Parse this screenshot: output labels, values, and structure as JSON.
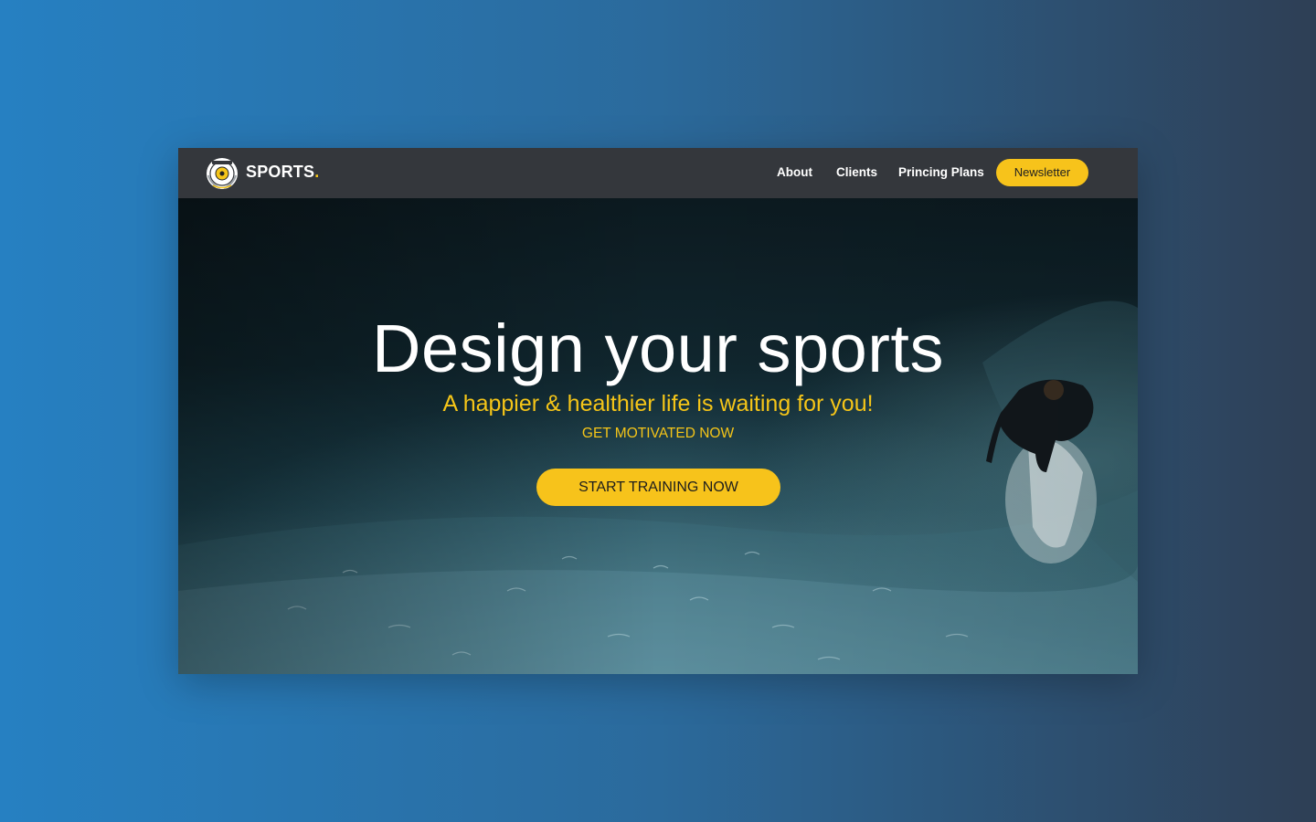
{
  "brand": {
    "name": "SPORTS",
    "dot": "."
  },
  "nav": {
    "links": [
      {
        "label": "About"
      },
      {
        "label": "Clients"
      },
      {
        "label": "Princing Plans"
      }
    ],
    "newsletter_label": "Newsletter"
  },
  "hero": {
    "title": "Design your sports",
    "subtitle": "A happier & healthier life is waiting for you!",
    "tag": "GET MOTIVATED NOW",
    "cta_label": "START TRAINING NOW"
  },
  "colors": {
    "accent": "#f7c31b",
    "navbar": "#34373c",
    "page_gradient_start": "#2680c2",
    "page_gradient_end": "#2e3f55"
  },
  "icons": {
    "logo": "club-emblem-icon"
  }
}
